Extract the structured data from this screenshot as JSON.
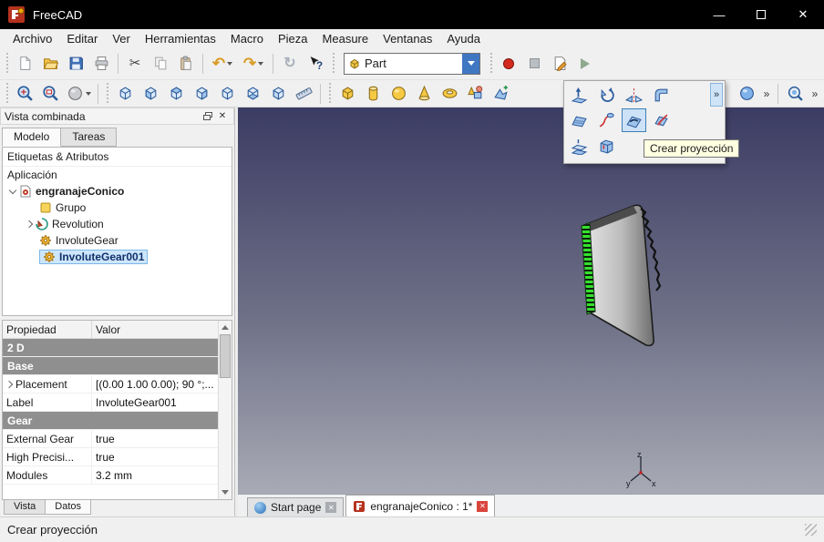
{
  "window": {
    "title": "FreeCAD"
  },
  "menu": {
    "items": [
      "Archivo",
      "Editar",
      "Ver",
      "Herramientas",
      "Macro",
      "Pieza",
      "Measure",
      "Ventanas",
      "Ayuda"
    ]
  },
  "toolbars": {
    "workbench_selected": "Part"
  },
  "icons": {
    "cut": "✂",
    "undo": "↶",
    "redo": "↷",
    "refresh": "↻",
    "overflow": "»",
    "close": "✕",
    "minimize": "—"
  },
  "toolbar_icon_names": {
    "standard": [
      "new-file",
      "open-file",
      "save",
      "print",
      "cut",
      "copy",
      "paste",
      "undo",
      "redo",
      "refresh",
      "whats-this"
    ],
    "macro": [
      "macro-record",
      "macro-stop",
      "macro-edit",
      "macro-play"
    ],
    "view": [
      "fit-all",
      "zoom-selection",
      "draw-style",
      "view-isometric",
      "view-front",
      "view-top",
      "view-right",
      "view-rear",
      "view-bottom",
      "view-left",
      "measure"
    ],
    "part": [
      "box",
      "cylinder",
      "sphere",
      "cone",
      "torus",
      "create-primitives",
      "shape-builder"
    ]
  },
  "flyout": {
    "tooltip": "Crear proyección",
    "icon_names": [
      "extrude",
      "revolve",
      "mirror",
      "fillet",
      "ruled-surface",
      "sweep",
      "projection",
      "cross-section",
      "offset",
      "thickness"
    ]
  },
  "combo_view": {
    "title": "Vista combinada",
    "tabs": [
      {
        "label": "Modelo"
      },
      {
        "label": "Tareas"
      }
    ],
    "tree": {
      "header": "Etiquetas & Atributos",
      "app": "Aplicación",
      "items": [
        {
          "label": "engranajeConico"
        },
        {
          "label": "Grupo"
        },
        {
          "label": "Revolution"
        },
        {
          "label": "InvoluteGear"
        },
        {
          "label": "InvoluteGear001"
        }
      ]
    },
    "properties": {
      "headers": [
        "Propiedad",
        "Valor"
      ],
      "rows": [
        {
          "kind": "group",
          "name": "2 D",
          "value": ""
        },
        {
          "kind": "group",
          "name": "Base",
          "value": ""
        },
        {
          "kind": "prop",
          "name": "Placement",
          "value": "[(0.00 1.00 0.00); 90 °;..."
        },
        {
          "kind": "prop",
          "name": "Label",
          "value": "InvoluteGear001"
        },
        {
          "kind": "group",
          "name": "Gear",
          "value": ""
        },
        {
          "kind": "prop",
          "name": "External Gear",
          "value": "true"
        },
        {
          "kind": "prop",
          "name": "High Precisi...",
          "value": "true"
        },
        {
          "kind": "prop",
          "name": "Modules",
          "value": "3.2 mm"
        }
      ]
    },
    "bottom_tabs": [
      {
        "label": "Vista"
      },
      {
        "label": "Datos"
      }
    ]
  },
  "viewport": {
    "axis": {
      "x": "x",
      "y": "y",
      "z": "z"
    },
    "tabs": [
      {
        "label": "Start page"
      },
      {
        "label": "engranajeConico : 1*"
      }
    ]
  },
  "status_bar": {
    "message": "Crear proyección"
  },
  "colors": {
    "titlebar": "#000000",
    "selection": "#cde6fb",
    "viewport_top": "#3b3c63",
    "viewport_bottom": "#a8aab5",
    "highlight_green": "#35e02f",
    "tooltip_bg": "#ffffe1",
    "accent_blue": "#2d5c9e",
    "part_yellow": "#f6c945"
  }
}
